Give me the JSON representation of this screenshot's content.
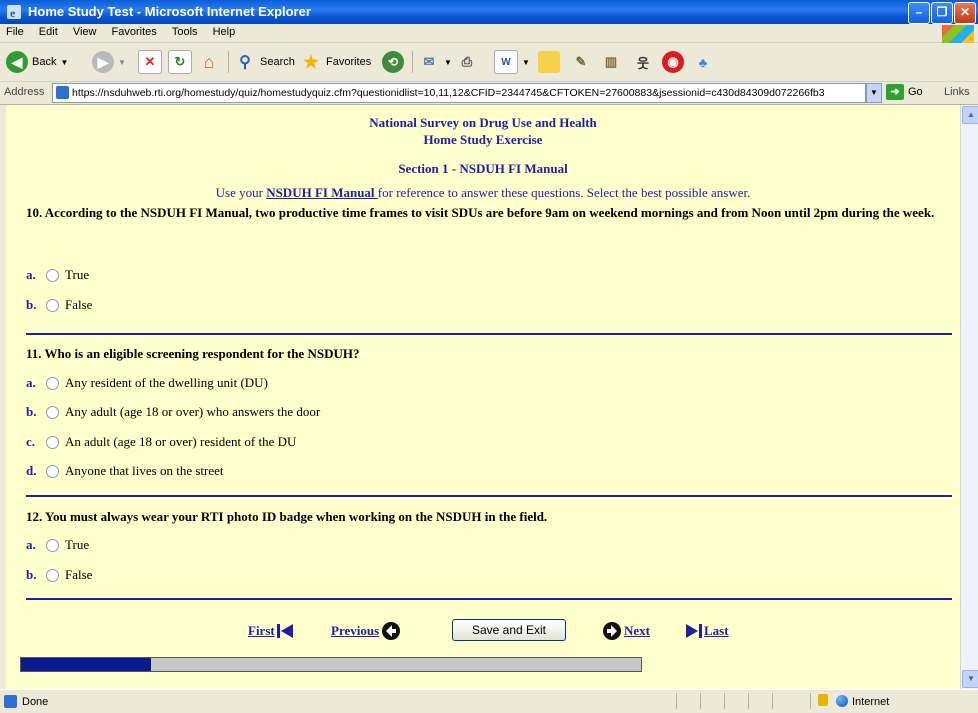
{
  "window": {
    "title": "Home Study Test - Microsoft Internet Explorer",
    "minimize": "–",
    "maximize": "❐",
    "close": "✕"
  },
  "menu": [
    "File",
    "Edit",
    "View",
    "Favorites",
    "Tools",
    "Help"
  ],
  "toolbar": {
    "back": "Back",
    "search": "Search",
    "favorites": "Favorites"
  },
  "address": {
    "label": "Address",
    "url": "https://nsduhweb.rti.org/homestudy/quiz/homestudyquiz.cfm?questionidlist=10,11,12&CFID=2344745&CFTOKEN=27600883&jsessionid=c430d84309d072266fb3",
    "go": "Go",
    "links": "Links"
  },
  "page": {
    "title1": "National Survey on Drug Use and Health",
    "title2": "Home Study Exercise",
    "section": "Section 1 - NSDUH FI Manual",
    "instr_before": "Use your ",
    "instr_link": "NSDUH FI Manual ",
    "instr_after": "for reference to answer these questions. Select the best possible answer."
  },
  "questions": [
    {
      "text": "10. According to the NSDUH FI Manual, two productive time frames to visit SDUs are before 9am on weekend mornings and from Noon until 2pm during the week.",
      "options": [
        {
          "letter": "a.",
          "text": "True"
        },
        {
          "letter": "b.",
          "text": "False"
        }
      ]
    },
    {
      "text": "11. Who is an eligible screening respondent for the NSDUH?",
      "options": [
        {
          "letter": "a.",
          "text": "Any resident of the dwelling unit (DU)"
        },
        {
          "letter": "b.",
          "text": "Any adult (age 18 or over) who answers the door"
        },
        {
          "letter": "c.",
          "text": "An adult (age 18 or over) resident of the DU"
        },
        {
          "letter": "d.",
          "text": "Anyone that lives on the street"
        }
      ]
    },
    {
      "text": "12. You must always wear your RTI photo ID badge when working on the NSDUH in the field.",
      "options": [
        {
          "letter": "a.",
          "text": "True"
        },
        {
          "letter": "b.",
          "text": "False"
        }
      ]
    }
  ],
  "nav": {
    "first": "First",
    "previous": "Previous",
    "save": "Save and Exit",
    "next": "Next",
    "last": "Last"
  },
  "progress": {
    "fraction": 0.21
  },
  "status": {
    "text": "Done",
    "zone": "Internet"
  }
}
